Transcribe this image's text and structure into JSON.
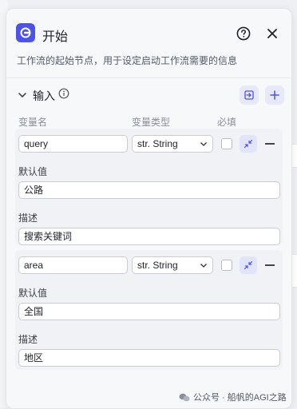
{
  "header": {
    "title": "开始",
    "description": "工作流的起始节点，用于设定启动工作流需要的信息"
  },
  "inputs_section": {
    "label": "输入",
    "columns": {
      "name": "变量名",
      "type": "变量类型",
      "required": "必填"
    }
  },
  "variables": [
    {
      "name": "query",
      "type": "str. String",
      "required": false,
      "default_label": "默认值",
      "default_value": "公路",
      "desc_label": "描述",
      "desc_value": "搜索关键词"
    },
    {
      "name": "area",
      "type": "str. String",
      "required": false,
      "default_label": "默认值",
      "default_value": "全国",
      "desc_label": "描述",
      "desc_value": "地区"
    }
  ],
  "watermark": "公众号 · 船帆的AGI之路",
  "colors": {
    "accent": "#4d53e8",
    "accent_light": "#e7e9fb"
  }
}
